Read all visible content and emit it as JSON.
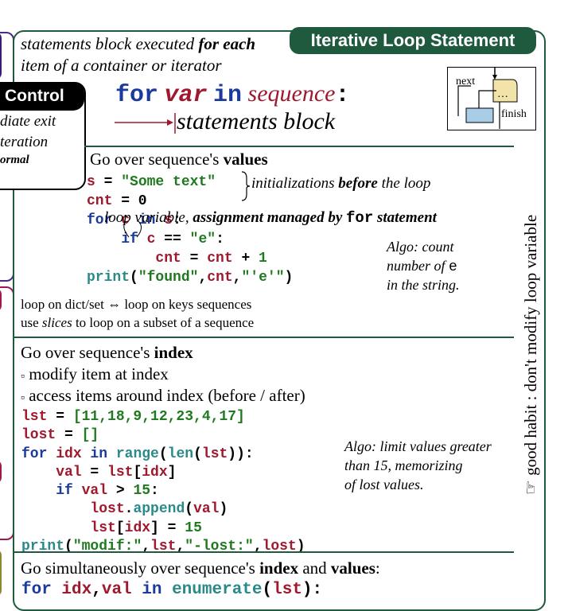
{
  "title": "Iterative Loop Statement",
  "sidebar": {
    "control_label": "Control",
    "lines": [
      "diate exit",
      "teration",
      "ormal"
    ]
  },
  "intro": {
    "line1_prefix": "statements block executed ",
    "line1_bold": "for each",
    "line2": "item of a container or iterator"
  },
  "syntax": {
    "kw_for": "for",
    "kw_var": "var",
    "kw_in": "in",
    "sequence": "sequence",
    "colon": ":",
    "block": "statements block"
  },
  "flow_diagram": {
    "next": "next",
    "finish": "finish",
    "dots": "…"
  },
  "values_section": {
    "heading_prefix": "Go over sequence's ",
    "heading_bold": "values",
    "code": [
      {
        "parts": [
          {
            "t": "s",
            "c": "red"
          },
          {
            "t": " = ",
            "c": ""
          },
          {
            "t": "\"Some text\"",
            "c": "green"
          }
        ]
      },
      {
        "parts": [
          {
            "t": "cnt",
            "c": "red"
          },
          {
            "t": " = 0",
            "c": ""
          }
        ]
      },
      {
        "parts": [
          {
            "t": "for ",
            "c": "blue"
          },
          {
            "t": "c",
            "c": "red"
          },
          {
            "t": " in ",
            "c": "blue"
          },
          {
            "t": "s",
            "c": "red"
          },
          {
            "t": ":",
            "c": ""
          }
        ]
      },
      {
        "parts": [
          {
            "t": "    if ",
            "c": "blue"
          },
          {
            "t": "c",
            "c": "red"
          },
          {
            "t": " == ",
            "c": ""
          },
          {
            "t": "\"e\"",
            "c": "green"
          },
          {
            "t": ":",
            "c": ""
          }
        ]
      },
      {
        "parts": [
          {
            "t": "        cnt",
            "c": "red"
          },
          {
            "t": " = ",
            "c": ""
          },
          {
            "t": "cnt",
            "c": "red"
          },
          {
            "t": " + ",
            "c": ""
          },
          {
            "t": "1",
            "c": "green"
          }
        ]
      },
      {
        "parts": [
          {
            "t": "print",
            "c": "teal"
          },
          {
            "t": "(",
            "c": ""
          },
          {
            "t": "\"found\"",
            "c": "green"
          },
          {
            "t": ",",
            "c": ""
          },
          {
            "t": "cnt",
            "c": "red"
          },
          {
            "t": ",",
            "c": ""
          },
          {
            "t": "\"'e'\"",
            "c": "green"
          },
          {
            "t": ")",
            "c": ""
          }
        ]
      }
    ],
    "init_note_prefix": "initializations ",
    "init_note_bold": "before",
    "init_note_suffix": " the loop",
    "loop_var_note_prefix": "loop variable, ",
    "loop_var_note_bold": "assignment managed by ",
    "loop_var_note_code": "for",
    "loop_var_note_suffix": " statement",
    "algo_line1": "Algo: count",
    "algo_line2_prefix": "number of ",
    "algo_line2_code": "e",
    "algo_line3": "in the string.",
    "note_dict": "loop on dict/set ⇔ loop on keys sequences",
    "note_slices_prefix": "use ",
    "note_slices_it": "slices",
    "note_slices_suffix": " to loop on a subset of a sequence"
  },
  "index_section": {
    "heading_prefix": "Go over sequence's ",
    "heading_bold": "index",
    "bullet1": "modify item at index",
    "bullet2": "access items around index (before / after)",
    "bullet_symbol": "▫",
    "code": [
      {
        "parts": [
          {
            "t": "lst",
            "c": "red"
          },
          {
            "t": " = ",
            "c": ""
          },
          {
            "t": "[11,18,9,12,23,4,17]",
            "c": "green"
          }
        ]
      },
      {
        "parts": [
          {
            "t": "lost",
            "c": "red"
          },
          {
            "t": " = ",
            "c": ""
          },
          {
            "t": "[]",
            "c": "green"
          }
        ]
      },
      {
        "parts": [
          {
            "t": "for ",
            "c": "blue"
          },
          {
            "t": "idx",
            "c": "red"
          },
          {
            "t": " in ",
            "c": "blue"
          },
          {
            "t": "range",
            "c": "teal"
          },
          {
            "t": "(",
            "c": ""
          },
          {
            "t": "len",
            "c": "teal"
          },
          {
            "t": "(",
            "c": ""
          },
          {
            "t": "lst",
            "c": "red"
          },
          {
            "t": ")):",
            "c": ""
          }
        ]
      },
      {
        "parts": [
          {
            "t": "    val",
            "c": "red"
          },
          {
            "t": " = ",
            "c": ""
          },
          {
            "t": "lst",
            "c": "red"
          },
          {
            "t": "[",
            "c": ""
          },
          {
            "t": "idx",
            "c": "red"
          },
          {
            "t": "]",
            "c": ""
          }
        ]
      },
      {
        "parts": [
          {
            "t": "    if ",
            "c": "blue"
          },
          {
            "t": "val",
            "c": "red"
          },
          {
            "t": " > ",
            "c": ""
          },
          {
            "t": "15",
            "c": "green"
          },
          {
            "t": ":",
            "c": ""
          }
        ]
      },
      {
        "parts": [
          {
            "t": "        lost",
            "c": "red"
          },
          {
            "t": ".",
            "c": ""
          },
          {
            "t": "append",
            "c": "teal"
          },
          {
            "t": "(",
            "c": ""
          },
          {
            "t": "val",
            "c": "red"
          },
          {
            "t": ")",
            "c": ""
          }
        ]
      },
      {
        "parts": [
          {
            "t": "        lst",
            "c": "red"
          },
          {
            "t": "[",
            "c": ""
          },
          {
            "t": "idx",
            "c": "red"
          },
          {
            "t": "] = ",
            "c": ""
          },
          {
            "t": "15",
            "c": "green"
          }
        ]
      },
      {
        "parts": [
          {
            "t": "print",
            "c": "teal"
          },
          {
            "t": "(",
            "c": ""
          },
          {
            "t": "\"modif:\"",
            "c": "green"
          },
          {
            "t": ",",
            "c": ""
          },
          {
            "t": "lst",
            "c": "red"
          },
          {
            "t": ",",
            "c": ""
          },
          {
            "t": "\"-lost:\"",
            "c": "green"
          },
          {
            "t": ",",
            "c": ""
          },
          {
            "t": "lost",
            "c": "red"
          },
          {
            "t": ")",
            "c": ""
          }
        ]
      }
    ],
    "algo_line1": "Algo: limit values greater",
    "algo_line2": "than 15, memorizing",
    "algo_line3": "of lost values."
  },
  "enum_section": {
    "heading_prefix": "Go simultaneously over sequence's ",
    "heading_bold1": "index",
    "heading_mid": " and ",
    "heading_bold2": "values",
    "heading_suffix": ":",
    "code": [
      {
        "parts": [
          {
            "t": "for ",
            "c": "blue"
          },
          {
            "t": "idx",
            "c": "red"
          },
          {
            "t": ",",
            "c": ""
          },
          {
            "t": "val",
            "c": "red"
          },
          {
            "t": " in ",
            "c": "blue"
          },
          {
            "t": "enumerate",
            "c": "teal"
          },
          {
            "t": "(",
            "c": ""
          },
          {
            "t": "lst",
            "c": "red"
          },
          {
            "t": "):",
            "c": ""
          }
        ]
      }
    ]
  },
  "side_note": "good habit : don't modify loop variable",
  "side_icon": "☞",
  "colors": {
    "frame": "#1f5a3f",
    "keyword": "#1b3a9e",
    "string": "#1f7a1f",
    "var": "#a0182d",
    "func": "#2a8a8a"
  }
}
